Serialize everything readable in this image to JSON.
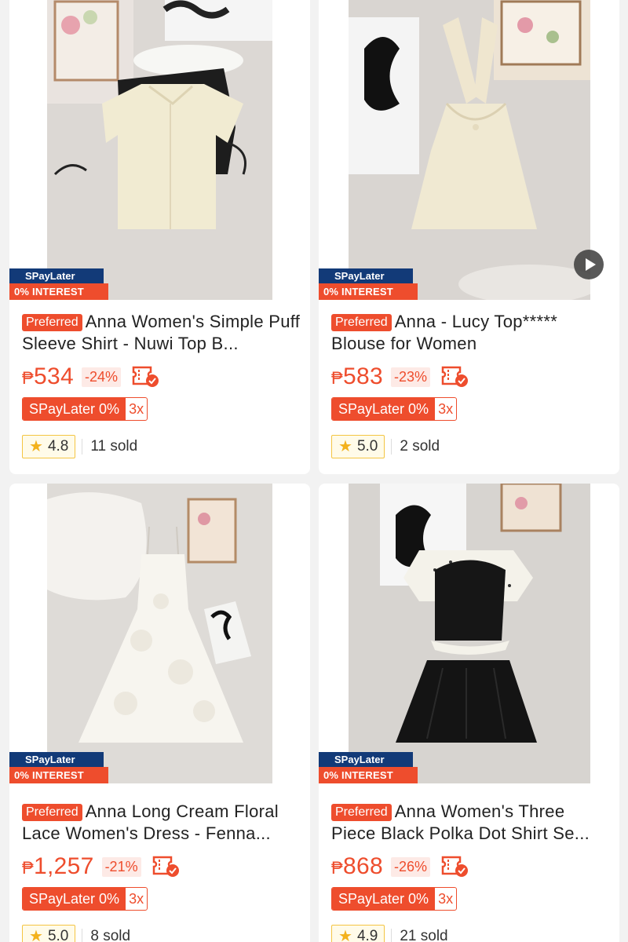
{
  "products": [
    {
      "badge_top": "SPayLater",
      "badge_bottom": "0% INTEREST",
      "preferred": "Preferred",
      "title": "Anna Women's Simple Puff Sleeve Shirt - Nuwi Top B...",
      "currency": "₱",
      "price": "534",
      "discount": "-24%",
      "spaylater": "SPayLater 0%",
      "installments": "3x",
      "rating": "4.8",
      "sold": "11 sold",
      "has_video": false
    },
    {
      "badge_top": "SPayLater",
      "badge_bottom": "0% INTEREST",
      "preferred": "Preferred",
      "title": "Anna - Lucy Top***** Blouse for Women",
      "currency": "₱",
      "price": "583",
      "discount": "-23%",
      "spaylater": "SPayLater 0%",
      "installments": "3x",
      "rating": "5.0",
      "sold": "2 sold",
      "has_video": true
    },
    {
      "badge_top": "SPayLater",
      "badge_bottom": "0% INTEREST",
      "preferred": "Preferred",
      "title": "Anna Long Cream Floral Lace Women's Dress - Fenna...",
      "currency": "₱",
      "price": "1,257",
      "discount": "-21%",
      "spaylater": "SPayLater 0%",
      "installments": "3x",
      "rating": "5.0",
      "sold": "8 sold",
      "has_video": false
    },
    {
      "badge_top": "SPayLater",
      "badge_bottom": "0% INTEREST",
      "preferred": "Preferred",
      "title": "Anna Women's Three Piece Black Polka Dot Shirt Se...",
      "currency": "₱",
      "price": "868",
      "discount": "-26%",
      "spaylater": "SPayLater 0%",
      "installments": "3x",
      "rating": "4.9",
      "sold": "21 sold",
      "has_video": false
    }
  ],
  "icons": {
    "rating": "star-icon",
    "voucher": "voucher-icon",
    "video": "play-icon"
  },
  "colors": {
    "brand": "#ee4d2d",
    "spaylater_blue": "#123a78",
    "star": "#f3b11c"
  }
}
